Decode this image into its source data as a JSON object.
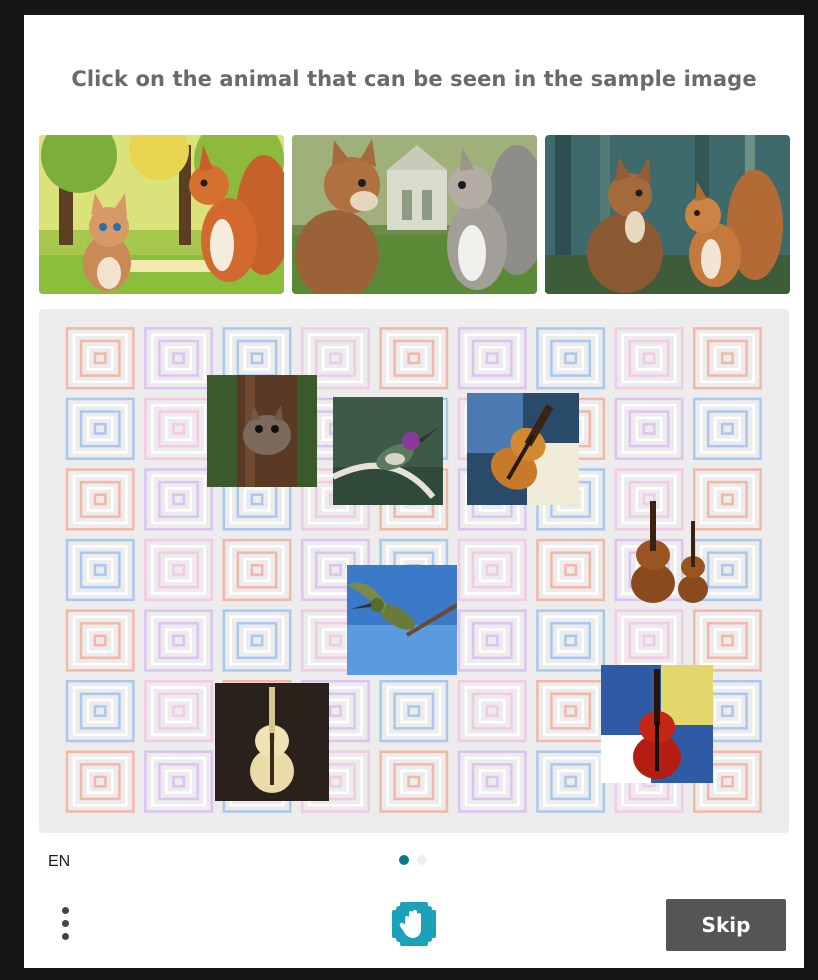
{
  "challenge": {
    "prompt": "Click on the animal that can be seen in the sample image"
  },
  "samples": [
    {
      "name": "sample-cat-and-squirrel-cartoon"
    },
    {
      "name": "sample-cat-and-squirrel-garden"
    },
    {
      "name": "sample-cat-and-squirrel-forest"
    }
  ],
  "grid_items": [
    {
      "name": "squirrel-on-tree"
    },
    {
      "name": "hummingbird-perched"
    },
    {
      "name": "violin-painted"
    },
    {
      "name": "two-violins"
    },
    {
      "name": "hummingbird-flying"
    },
    {
      "name": "violin-cream"
    },
    {
      "name": "violin-red"
    }
  ],
  "footer": {
    "language": "EN",
    "page_indicator": {
      "current": 1,
      "total": 2
    },
    "skip_label": "Skip"
  },
  "colors": {
    "prompt_text": "#6a6a6a",
    "skip_button": "#555555",
    "active_dot": "#0b7886",
    "logo": "#1aa3b8"
  }
}
